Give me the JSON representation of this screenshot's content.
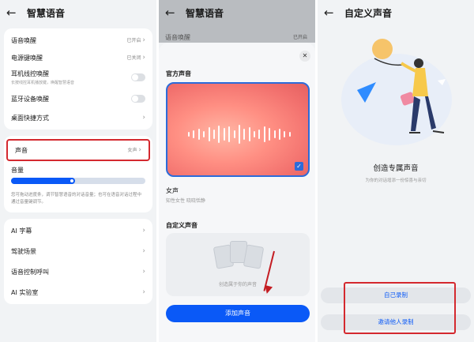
{
  "colors": {
    "accent": "#0a59f7",
    "highlight": "#d4292f",
    "background": "#f1f3f5"
  },
  "panel1": {
    "back_icon": "arrow-left-icon",
    "title": "智慧语音",
    "rows": [
      {
        "label": "语音唤醒",
        "value": "已开启"
      },
      {
        "label": "电源键唤醒",
        "value": "已关闭"
      }
    ],
    "earphone": {
      "label": "耳机线控唤醒",
      "sub": "长按线控耳机播放键，唤醒智慧语音"
    },
    "bluetooth": {
      "label": "蓝牙设备唤醒"
    },
    "shortcut": {
      "label": "桌面快捷方式"
    },
    "voice": {
      "label": "声音",
      "value": "女声"
    },
    "volume": {
      "label": "音量",
      "level_percent": 47
    },
    "note": "您可拖动进度条，调节智慧语音的对话音量；也可在语音对话过程中通过音量键调节。",
    "bottom_rows": [
      {
        "label": "AI 字幕"
      },
      {
        "label": "驾驶场景"
      },
      {
        "label": "语音控制呼叫"
      },
      {
        "label": "AI 实验室"
      }
    ]
  },
  "panel2": {
    "title": "智慧语音",
    "behind_row": "语音唤醒",
    "behind_value": "已开启",
    "official_title": "官方声音",
    "voice_name": "女声",
    "voice_desc": "知性女性 晓晓恬静",
    "custom_title": "自定义声音",
    "custom_empty": "创造属于你的声音",
    "add_button": "添加声音",
    "close_icon": "close-icon"
  },
  "panel3": {
    "title": "自定义声音",
    "create_title": "创造专属声音",
    "create_sub": "为你的对话增添一份惊喜与亲切",
    "self_record": "自己录制",
    "invite_record": "邀请他人录制"
  }
}
